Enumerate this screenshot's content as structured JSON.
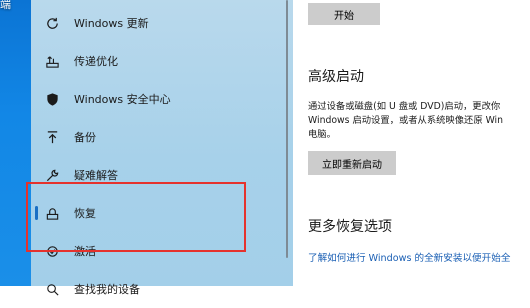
{
  "desktop": {
    "label": "端"
  },
  "sidebar": {
    "items": [
      {
        "label": "Windows 更新",
        "icon": "refresh-icon"
      },
      {
        "label": "传递优化",
        "icon": "delivery-optimization-icon"
      },
      {
        "label": "Windows 安全中心",
        "icon": "shield-icon"
      },
      {
        "label": "备份",
        "icon": "backup-upload-icon"
      },
      {
        "label": "疑难解答",
        "icon": "wrench-icon"
      },
      {
        "label": "恢复",
        "icon": "recovery-icon"
      },
      {
        "label": "激活",
        "icon": "activation-icon"
      },
      {
        "label": "查找我的设备",
        "icon": "find-device-icon"
      }
    ],
    "active_index": 5
  },
  "main": {
    "start_button": "开始",
    "advanced_startup": {
      "title": "高级启动",
      "lines": [
        "通过设备或磁盘(如 U 盘或 DVD)启动，更改你",
        "Windows 启动设置，或者从系统映像还原 Win",
        "电脑。"
      ],
      "restart_button": "立即重新启动"
    },
    "more_options": {
      "title": "更多恢复选项",
      "link": "了解如何进行 Windows 的全新安装以便开始全"
    }
  }
}
